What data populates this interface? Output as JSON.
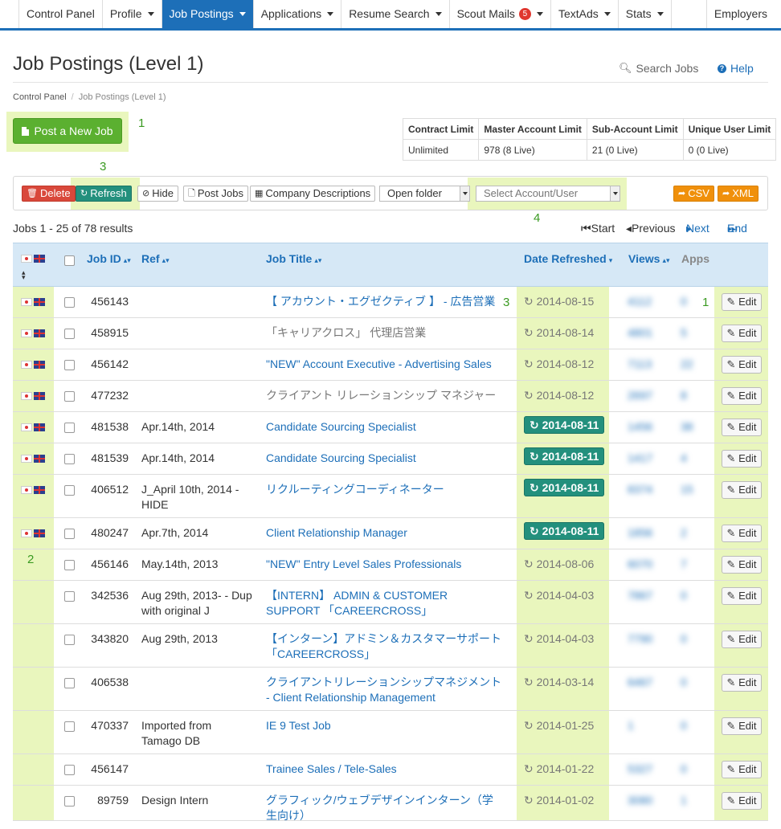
{
  "nav": {
    "items": [
      {
        "label": "Control Panel",
        "caret": false,
        "active": false
      },
      {
        "label": "Profile",
        "caret": true,
        "active": false
      },
      {
        "label": "Job Postings",
        "caret": true,
        "active": true
      },
      {
        "label": "Applications",
        "caret": true,
        "active": false
      },
      {
        "label": "Resume Search",
        "caret": true,
        "active": false
      },
      {
        "label": "Scout Mails",
        "caret": true,
        "active": false,
        "badge": "5"
      },
      {
        "label": "TextAds",
        "caret": true,
        "active": false
      },
      {
        "label": "Stats",
        "caret": true,
        "active": false
      }
    ],
    "right_label": "Employers"
  },
  "header": {
    "title": "Job Postings (Level 1)",
    "search_label": "Search Jobs",
    "help_label": "Help"
  },
  "breadcrumb": {
    "root": "Control Panel",
    "current": "Job Postings (Level 1)"
  },
  "post_button": "Post a New Job",
  "annotations": {
    "a1": "1",
    "a2": "2",
    "a3": "3",
    "a4": "4"
  },
  "limits": {
    "headers": [
      "Contract Limit",
      "Master Account Limit",
      "Sub-Account Limit",
      "Unique User Limit"
    ],
    "values": [
      "Unlimited",
      "978 (8 Live)",
      "21 (0 Live)",
      "0 (0 Live)"
    ]
  },
  "toolbar": {
    "delete": "Delete",
    "refresh": "Refresh",
    "hide": "Hide",
    "post_jobs": "Post Jobs",
    "company_descriptions": "Company Descriptions",
    "open_folder": "Open folder",
    "select_account": "Select Account/User",
    "csv": "CSV",
    "xml": "XML"
  },
  "results_text": "Jobs 1 - 25 of 78 results",
  "pager": {
    "start": "Start",
    "previous": "Previous",
    "next": "Next",
    "end": "End"
  },
  "columns": {
    "job_id": "Job ID",
    "ref": "Ref",
    "job_title": "Job Title",
    "date_refreshed": "Date Refreshed",
    "views": "Views",
    "apps": "Apps"
  },
  "edit_label": "Edit",
  "colors": {
    "accent": "#1d6fb8",
    "green_button": "#5bb030",
    "teal": "#23907d",
    "highlight": "#e9f6bd",
    "orange": "#f0900b",
    "red": "#d9483b"
  },
  "rows": [
    {
      "flags": true,
      "id": "456143",
      "ref": "",
      "title": "【 アカウント・エグゼクティブ 】 - 広告営業",
      "title_link": true,
      "date": "2014-08-15",
      "date_badge": false,
      "views": "4112",
      "apps": "0"
    },
    {
      "flags": true,
      "id": "458915",
      "ref": "",
      "title": "「キャリアクロス」 代理店営業",
      "title_link": false,
      "date": "2014-08-14",
      "date_badge": false,
      "views": "4801",
      "apps": "5"
    },
    {
      "flags": true,
      "id": "456142",
      "ref": "",
      "title": "\"NEW\" Account Executive - Advertising Sales",
      "title_link": true,
      "date": "2014-08-12",
      "date_badge": false,
      "views": "7113",
      "apps": "22"
    },
    {
      "flags": true,
      "id": "477232",
      "ref": "",
      "title": "クライアント リレーションシップ マネジャー",
      "title_link": false,
      "date": "2014-08-12",
      "date_badge": false,
      "views": "2697",
      "apps": "8"
    },
    {
      "flags": true,
      "id": "481538",
      "ref": "Apr.14th, 2014",
      "title": "Candidate Sourcing Specialist",
      "title_link": true,
      "date": "2014-08-11",
      "date_badge": true,
      "views": "1456",
      "apps": "38"
    },
    {
      "flags": true,
      "id": "481539",
      "ref": "Apr.14th, 2014",
      "title": "Candidate Sourcing Specialist",
      "title_link": true,
      "date": "2014-08-11",
      "date_badge": true,
      "views": "1417",
      "apps": "4"
    },
    {
      "flags": true,
      "id": "406512",
      "ref": "J_April 10th, 2014 - HIDE",
      "title": "リクルーティングコーディネーター",
      "title_link": true,
      "date": "2014-08-11",
      "date_badge": true,
      "views": "8374",
      "apps": "15"
    },
    {
      "flags": true,
      "id": "480247",
      "ref": "Apr.7th, 2014",
      "title": "Client Relationship Manager",
      "title_link": true,
      "date": "2014-08-11",
      "date_badge": true,
      "views": "1856",
      "apps": "2"
    },
    {
      "flags": false,
      "id": "456146",
      "ref": "May.14th, 2013",
      "title": "\"NEW\" Entry Level Sales Professionals",
      "title_link": true,
      "date": "2014-08-06",
      "date_badge": false,
      "views": "6070",
      "apps": "7"
    },
    {
      "flags": false,
      "id": "342536",
      "ref": "Aug 29th, 2013- - Dup with original J",
      "title": "【INTERN】 ADMIN & CUSTOMER SUPPORT 「CAREERCROSS」",
      "title_link": true,
      "date": "2014-04-03",
      "date_badge": false,
      "views": "7867",
      "apps": "0"
    },
    {
      "flags": false,
      "id": "343820",
      "ref": "Aug 29th, 2013",
      "title": "【インターン】アドミン＆カスタマーサポート 「CAREERCROSS」",
      "title_link": true,
      "date": "2014-04-03",
      "date_badge": false,
      "views": "7790",
      "apps": "0"
    },
    {
      "flags": false,
      "id": "406538",
      "ref": "",
      "title": "クライアントリレーションシップマネジメント - Client Relationship Management",
      "title_link": true,
      "date": "2014-03-14",
      "date_badge": false,
      "views": "6467",
      "apps": "0"
    },
    {
      "flags": false,
      "id": "470337",
      "ref": "Imported from Tamago DB",
      "title": "IE 9 Test Job",
      "title_link": true,
      "date": "2014-01-25",
      "date_badge": false,
      "views": "1",
      "apps": "0"
    },
    {
      "flags": false,
      "id": "456147",
      "ref": "",
      "title": "Trainee Sales / Tele-Sales",
      "title_link": true,
      "date": "2014-01-22",
      "date_badge": false,
      "views": "5327",
      "apps": "0"
    },
    {
      "flags": false,
      "id": "89759",
      "ref": "Design Intern",
      "title": "グラフィック/ウェブデザインインターン（学生向け）",
      "title_link": true,
      "date": "2014-01-02",
      "date_badge": false,
      "views": "3080",
      "apps": "1"
    }
  ]
}
